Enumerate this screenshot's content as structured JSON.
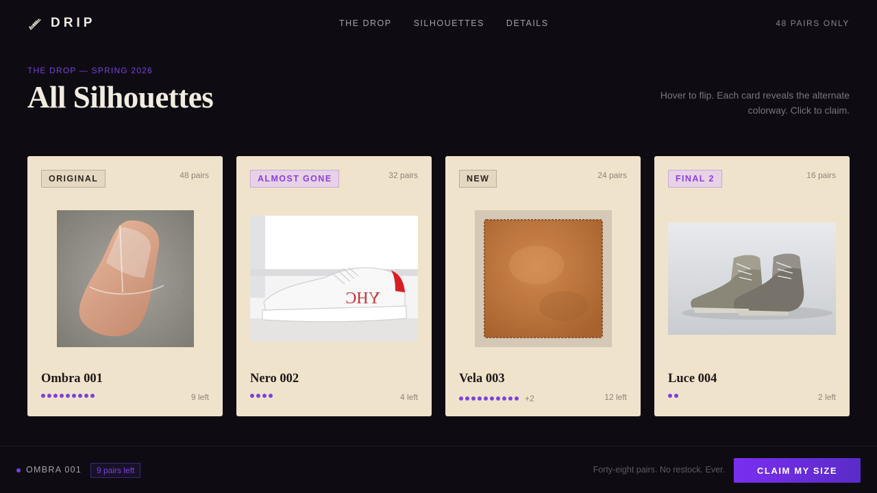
{
  "brand": {
    "name": "DRIP",
    "icon": "sneaker-icon"
  },
  "nav": [
    {
      "label": "THE DROP"
    },
    {
      "label": "SILHOUETTES"
    },
    {
      "label": "DETAILS"
    }
  ],
  "limit_text": "48 PAIRS ONLY",
  "hero": {
    "eyebrow": "THE DROP — SPRING 2026",
    "title": "All Silhouettes",
    "hint": "Hover to flip. Each card reveals the alternate colorway. Click to claim."
  },
  "cards": [
    {
      "badge": "ORIGINAL",
      "pairs": "48 pairs",
      "name": "Ombra 001",
      "left": "9 left",
      "dots": 9,
      "more": "",
      "image": "clear-slide-sandal"
    },
    {
      "badge": "ALMOST GONE",
      "pairs": "32 pairs",
      "name": "Nero 002",
      "left": "4 left",
      "dots": 4,
      "more": "",
      "image": "white-sneaker"
    },
    {
      "badge": "NEW",
      "pairs": "24 pairs",
      "name": "Vela 003",
      "left": "12 left",
      "dots": 10,
      "more": "+2",
      "image": "tan-suede-swatch"
    },
    {
      "badge": "FINAL 2",
      "pairs": "16 pairs",
      "name": "Luce 004",
      "left": "2 left",
      "dots": 2,
      "more": "",
      "image": "high-top-boots"
    }
  ],
  "selection": {
    "name": "OMBRA 001",
    "count": "9 pairs left"
  },
  "tagline": "Forty-eight pairs. No restock. Ever.",
  "cta": "CLAIM MY SIZE",
  "colors": {
    "accent": "#7d3fe0",
    "card": "#efe3cc",
    "background": "#0e0c12"
  }
}
